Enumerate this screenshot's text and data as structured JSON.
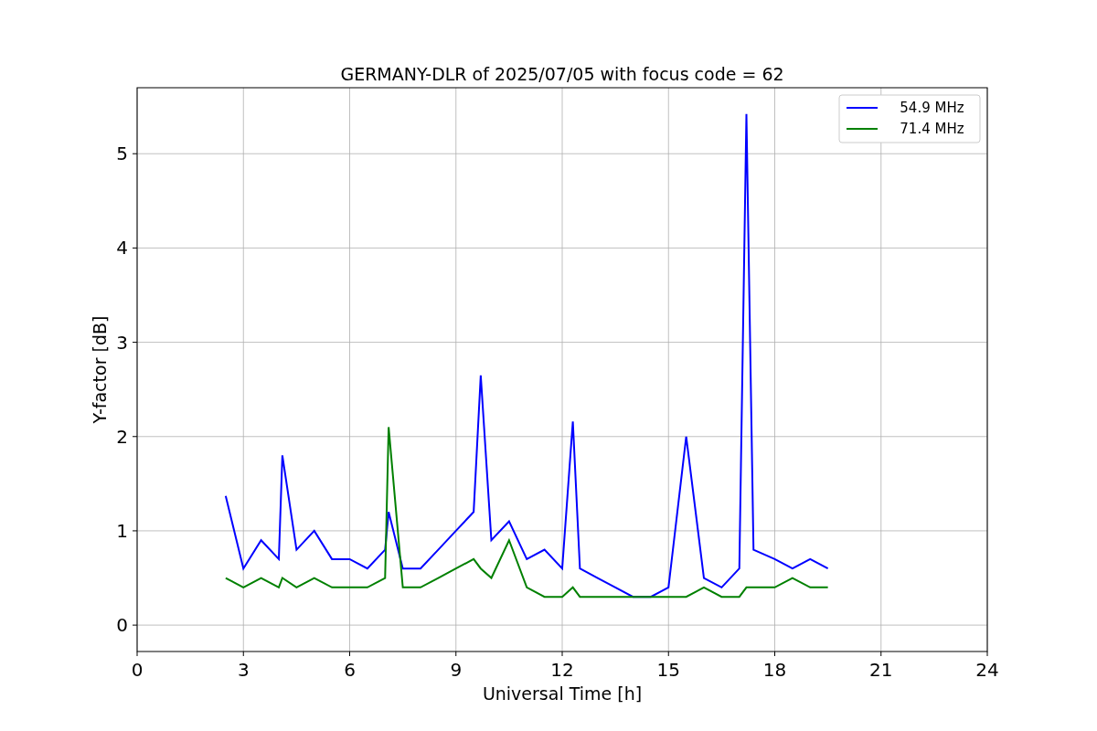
{
  "figure": {
    "chart_data": {
      "type": "line",
      "title": "GERMANY-DLR of 2025/07/05 with focus code = 62",
      "xlabel": "Universal Time [h]",
      "ylabel": "Y-factor [dB]",
      "xlim": [
        0,
        24
      ],
      "ylim": [
        -0.28,
        5.7
      ],
      "xticks": [
        0,
        3,
        6,
        9,
        12,
        15,
        18,
        21,
        24
      ],
      "yticks": [
        0,
        1,
        2,
        3,
        4,
        5
      ],
      "grid": true,
      "legend": true,
      "x": [
        2.5,
        3,
        3.5,
        4,
        4.1,
        4.5,
        5,
        5.5,
        6,
        6.5,
        7,
        7.1,
        7.5,
        8,
        8.5,
        9,
        9.5,
        9.7,
        10,
        10.5,
        11,
        11.5,
        12,
        12.3,
        12.5,
        13,
        13.5,
        14,
        14.5,
        15,
        15.5,
        16,
        16.5,
        17,
        17.2,
        17.4,
        18,
        18.5,
        19,
        19.5
      ],
      "series": [
        {
          "name": "   54.9 MHz",
          "color": "#0000ff",
          "values": [
            1.37,
            0.6,
            0.9,
            0.7,
            1.8,
            0.8,
            1.0,
            0.7,
            0.7,
            0.6,
            0.8,
            1.2,
            0.6,
            0.6,
            0.8,
            1.0,
            1.2,
            2.65,
            0.9,
            1.1,
            0.7,
            0.8,
            0.6,
            2.16,
            0.6,
            0.5,
            0.4,
            0.3,
            0.3,
            0.4,
            2.0,
            0.5,
            0.4,
            0.6,
            5.42,
            0.8,
            0.7,
            0.6,
            0.7,
            0.6
          ]
        },
        {
          "name": "   71.4 MHz",
          "color": "#008000",
          "values": [
            0.5,
            0.4,
            0.5,
            0.4,
            0.5,
            0.4,
            0.5,
            0.4,
            0.4,
            0.4,
            0.5,
            2.1,
            0.4,
            0.4,
            0.5,
            0.6,
            0.7,
            0.6,
            0.5,
            0.9,
            0.4,
            0.3,
            0.3,
            0.4,
            0.3,
            0.3,
            0.3,
            0.3,
            0.3,
            0.3,
            0.3,
            0.4,
            0.3,
            0.3,
            0.4,
            0.4,
            0.4,
            0.5,
            0.4,
            0.4
          ]
        }
      ]
    }
  }
}
